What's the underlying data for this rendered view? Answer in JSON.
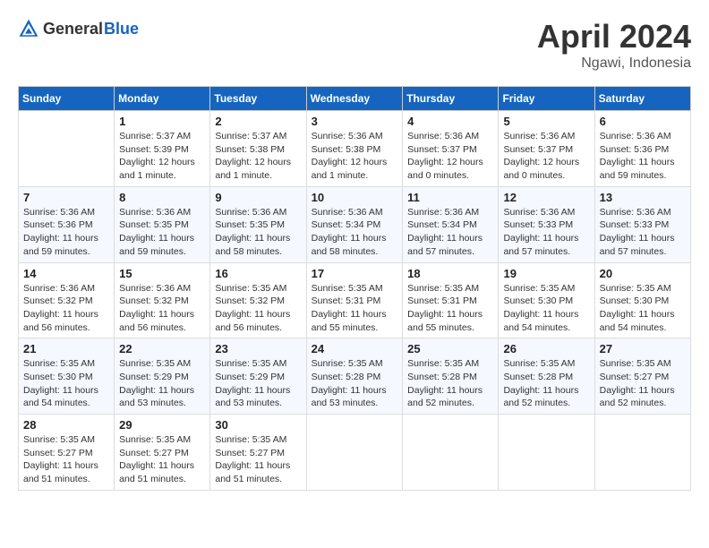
{
  "header": {
    "logo_general": "General",
    "logo_blue": "Blue",
    "title": "April 2024",
    "location": "Ngawi, Indonesia"
  },
  "columns": [
    "Sunday",
    "Monday",
    "Tuesday",
    "Wednesday",
    "Thursday",
    "Friday",
    "Saturday"
  ],
  "weeks": [
    [
      {
        "day": "",
        "info": ""
      },
      {
        "day": "1",
        "info": "Sunrise: 5:37 AM\nSunset: 5:39 PM\nDaylight: 12 hours\nand 1 minute."
      },
      {
        "day": "2",
        "info": "Sunrise: 5:37 AM\nSunset: 5:38 PM\nDaylight: 12 hours\nand 1 minute."
      },
      {
        "day": "3",
        "info": "Sunrise: 5:36 AM\nSunset: 5:38 PM\nDaylight: 12 hours\nand 1 minute."
      },
      {
        "day": "4",
        "info": "Sunrise: 5:36 AM\nSunset: 5:37 PM\nDaylight: 12 hours\nand 0 minutes."
      },
      {
        "day": "5",
        "info": "Sunrise: 5:36 AM\nSunset: 5:37 PM\nDaylight: 12 hours\nand 0 minutes."
      },
      {
        "day": "6",
        "info": "Sunrise: 5:36 AM\nSunset: 5:36 PM\nDaylight: 11 hours\nand 59 minutes."
      }
    ],
    [
      {
        "day": "7",
        "info": "Sunrise: 5:36 AM\nSunset: 5:36 PM\nDaylight: 11 hours\nand 59 minutes."
      },
      {
        "day": "8",
        "info": "Sunrise: 5:36 AM\nSunset: 5:35 PM\nDaylight: 11 hours\nand 59 minutes."
      },
      {
        "day": "9",
        "info": "Sunrise: 5:36 AM\nSunset: 5:35 PM\nDaylight: 11 hours\nand 58 minutes."
      },
      {
        "day": "10",
        "info": "Sunrise: 5:36 AM\nSunset: 5:34 PM\nDaylight: 11 hours\nand 58 minutes."
      },
      {
        "day": "11",
        "info": "Sunrise: 5:36 AM\nSunset: 5:34 PM\nDaylight: 11 hours\nand 57 minutes."
      },
      {
        "day": "12",
        "info": "Sunrise: 5:36 AM\nSunset: 5:33 PM\nDaylight: 11 hours\nand 57 minutes."
      },
      {
        "day": "13",
        "info": "Sunrise: 5:36 AM\nSunset: 5:33 PM\nDaylight: 11 hours\nand 57 minutes."
      }
    ],
    [
      {
        "day": "14",
        "info": "Sunrise: 5:36 AM\nSunset: 5:32 PM\nDaylight: 11 hours\nand 56 minutes."
      },
      {
        "day": "15",
        "info": "Sunrise: 5:36 AM\nSunset: 5:32 PM\nDaylight: 11 hours\nand 56 minutes."
      },
      {
        "day": "16",
        "info": "Sunrise: 5:35 AM\nSunset: 5:32 PM\nDaylight: 11 hours\nand 56 minutes."
      },
      {
        "day": "17",
        "info": "Sunrise: 5:35 AM\nSunset: 5:31 PM\nDaylight: 11 hours\nand 55 minutes."
      },
      {
        "day": "18",
        "info": "Sunrise: 5:35 AM\nSunset: 5:31 PM\nDaylight: 11 hours\nand 55 minutes."
      },
      {
        "day": "19",
        "info": "Sunrise: 5:35 AM\nSunset: 5:30 PM\nDaylight: 11 hours\nand 54 minutes."
      },
      {
        "day": "20",
        "info": "Sunrise: 5:35 AM\nSunset: 5:30 PM\nDaylight: 11 hours\nand 54 minutes."
      }
    ],
    [
      {
        "day": "21",
        "info": "Sunrise: 5:35 AM\nSunset: 5:30 PM\nDaylight: 11 hours\nand 54 minutes."
      },
      {
        "day": "22",
        "info": "Sunrise: 5:35 AM\nSunset: 5:29 PM\nDaylight: 11 hours\nand 53 minutes."
      },
      {
        "day": "23",
        "info": "Sunrise: 5:35 AM\nSunset: 5:29 PM\nDaylight: 11 hours\nand 53 minutes."
      },
      {
        "day": "24",
        "info": "Sunrise: 5:35 AM\nSunset: 5:28 PM\nDaylight: 11 hours\nand 53 minutes."
      },
      {
        "day": "25",
        "info": "Sunrise: 5:35 AM\nSunset: 5:28 PM\nDaylight: 11 hours\nand 52 minutes."
      },
      {
        "day": "26",
        "info": "Sunrise: 5:35 AM\nSunset: 5:28 PM\nDaylight: 11 hours\nand 52 minutes."
      },
      {
        "day": "27",
        "info": "Sunrise: 5:35 AM\nSunset: 5:27 PM\nDaylight: 11 hours\nand 52 minutes."
      }
    ],
    [
      {
        "day": "28",
        "info": "Sunrise: 5:35 AM\nSunset: 5:27 PM\nDaylight: 11 hours\nand 51 minutes."
      },
      {
        "day": "29",
        "info": "Sunrise: 5:35 AM\nSunset: 5:27 PM\nDaylight: 11 hours\nand 51 minutes."
      },
      {
        "day": "30",
        "info": "Sunrise: 5:35 AM\nSunset: 5:27 PM\nDaylight: 11 hours\nand 51 minutes."
      },
      {
        "day": "",
        "info": ""
      },
      {
        "day": "",
        "info": ""
      },
      {
        "day": "",
        "info": ""
      },
      {
        "day": "",
        "info": ""
      }
    ]
  ]
}
